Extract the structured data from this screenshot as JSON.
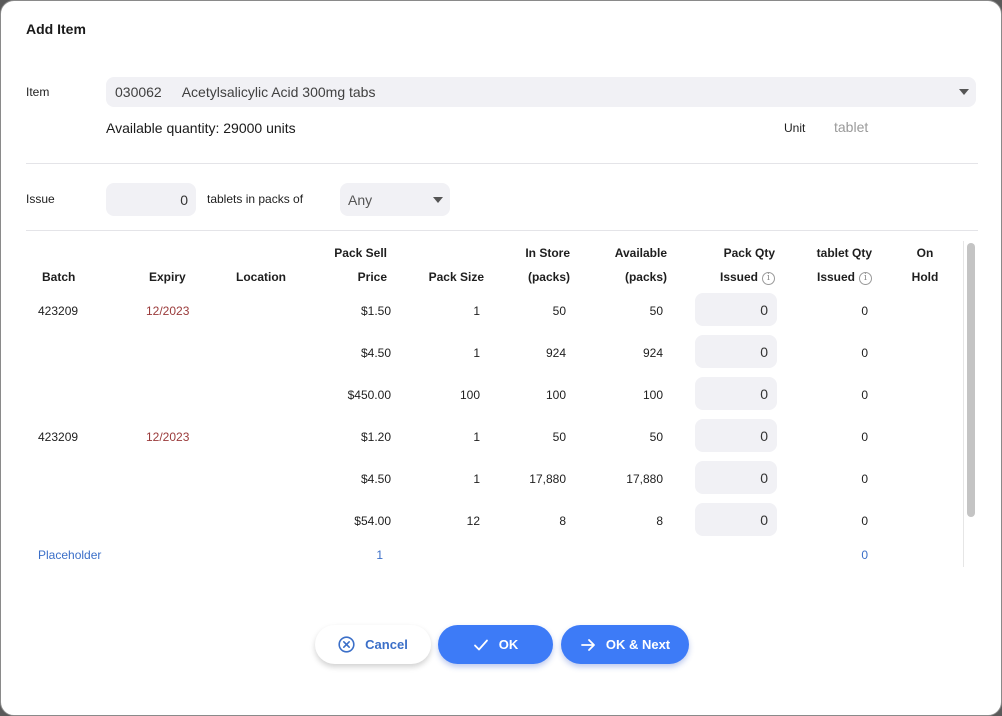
{
  "dialog": {
    "title": "Add Item"
  },
  "item": {
    "label": "Item",
    "code": "030062",
    "name": "Acetylsalicylic Acid 300mg tabs",
    "available_quantity": "Available quantity: 29000 units",
    "unit_label": "Unit",
    "unit_value": "tablet"
  },
  "issue": {
    "label": "Issue",
    "value": "0",
    "packs_text": "tablets in packs of",
    "pack_size_selected": "Any"
  },
  "table": {
    "headers": {
      "batch": "Batch",
      "expiry": "Expiry",
      "location": "Location",
      "pack_sell_price_1": "Pack Sell",
      "pack_sell_price_2": "Price",
      "pack_size": "Pack Size",
      "in_store_1": "In Store",
      "in_store_2": "(packs)",
      "available_1": "Available",
      "available_2": "(packs)",
      "pack_qty_1": "Pack Qty",
      "pack_qty_2": "Issued",
      "unit_qty_1": "tablet Qty",
      "unit_qty_2": "Issued",
      "on_hold_1": "On",
      "on_hold_2": "Hold"
    },
    "rows": [
      {
        "batch": "423209",
        "expiry": "12/2023",
        "price": "$1.50",
        "pack_size": "1",
        "in_store": "50",
        "available": "50",
        "pack_qty": "0",
        "unit_qty": "0"
      },
      {
        "batch": "",
        "expiry": "",
        "price": "$4.50",
        "pack_size": "1",
        "in_store": "924",
        "available": "924",
        "pack_qty": "0",
        "unit_qty": "0"
      },
      {
        "batch": "",
        "expiry": "",
        "price": "$450.00",
        "pack_size": "100",
        "in_store": "100",
        "available": "100",
        "pack_qty": "0",
        "unit_qty": "0"
      },
      {
        "batch": "423209",
        "expiry": "12/2023",
        "price": "$1.20",
        "pack_size": "1",
        "in_store": "50",
        "available": "50",
        "pack_qty": "0",
        "unit_qty": "0"
      },
      {
        "batch": "",
        "expiry": "",
        "price": "$4.50",
        "pack_size": "1",
        "in_store": "17,880",
        "available": "17,880",
        "pack_qty": "0",
        "unit_qty": "0"
      },
      {
        "batch": "",
        "expiry": "",
        "price": "$54.00",
        "pack_size": "12",
        "in_store": "8",
        "available": "8",
        "pack_qty": "0",
        "unit_qty": "0"
      }
    ],
    "placeholder": {
      "batch": "Placeholder",
      "pack_size": "1",
      "unit_qty": "0"
    }
  },
  "buttons": {
    "cancel": "Cancel",
    "ok": "OK",
    "ok_next": "OK & Next"
  },
  "colors": {
    "accent": "#3d7bf7",
    "expiry": "#9a3a3a",
    "link": "#3b6fc8"
  },
  "icons": {
    "cancel": "x-circle-icon",
    "ok": "check-icon",
    "ok_next": "arrow-right-icon",
    "info": "info-icon",
    "dropdown": "caret-down-icon"
  }
}
